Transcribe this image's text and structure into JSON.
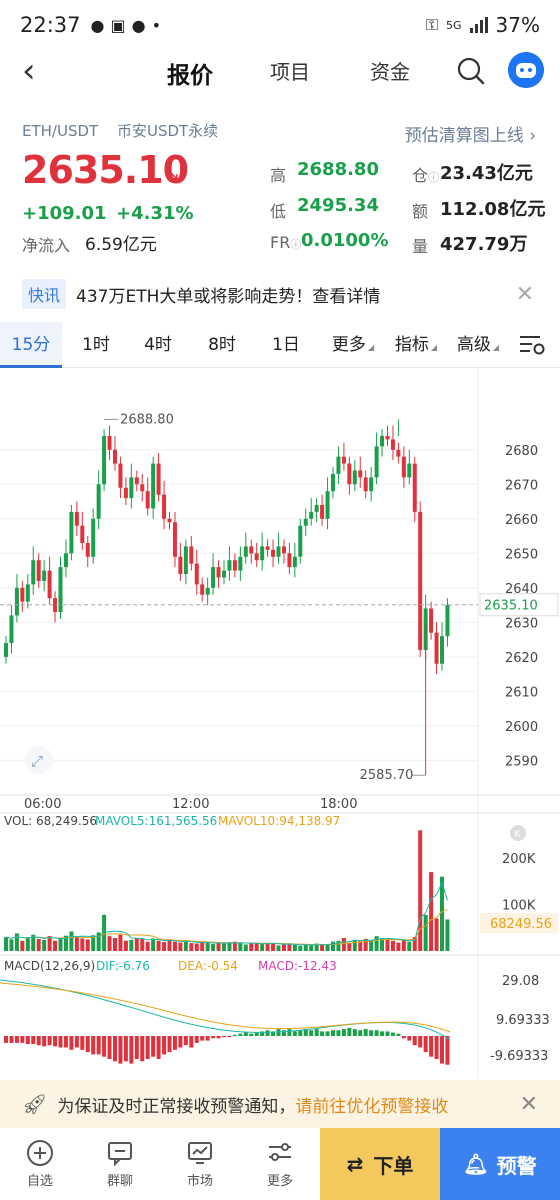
{
  "status_bar": {
    "time": "22:37",
    "battery": "37%",
    "net": "5G"
  },
  "nav": {
    "tabs": [
      "报价",
      "项目",
      "资金"
    ]
  },
  "header": {
    "pair": "ETH/USDT",
    "market": "币安USDT永续",
    "liq_link": "预估清算图上线 ›",
    "price": "2635.10",
    "change_abs": "+109.01",
    "change_pct": "+4.31%",
    "inflow_label": "净流入",
    "inflow_value": "6.59亿元",
    "high_label": "高",
    "high": "2688.80",
    "low_label": "低",
    "low": "2495.34",
    "fr_label": "FR",
    "fr": "0.0100%",
    "oi_label": "仓",
    "oi": "23.43亿元",
    "amount_label": "额",
    "amount": "112.08亿元",
    "volume_label": "量",
    "volume": "427.79万"
  },
  "news": {
    "tag": "快讯",
    "text": "437万ETH大单或将影响走势！查看详情"
  },
  "intervals": [
    "15分",
    "1时",
    "4时",
    "8时",
    "1日",
    "更多",
    "指标",
    "高级"
  ],
  "chart_data": [
    {
      "type": "candlestick",
      "y_ticks": [
        2680,
        2670,
        2660,
        2650,
        2640,
        2630,
        2620,
        2610,
        2600,
        2590
      ],
      "ylim": [
        2582,
        2695
      ],
      "x_ticks": [
        "06:00",
        "12:00",
        "18:00"
      ],
      "high_marker": "2688.80",
      "low_marker": "2585.70",
      "last_price": "2635.10",
      "closes": [
        2624,
        2632,
        2640,
        2636,
        2641,
        2648,
        2642,
        2645,
        2637,
        2633,
        2646,
        2650,
        2662,
        2658,
        2653,
        2649,
        2660,
        2670,
        2684,
        2680,
        2676,
        2669,
        2666,
        2672,
        2670,
        2668,
        2663,
        2676,
        2667,
        2660,
        2659,
        2649,
        2644,
        2652,
        2647,
        2641,
        2638,
        2640,
        2646,
        2643,
        2645,
        2648,
        2645,
        2649,
        2652,
        2650,
        2648,
        2652,
        2651,
        2649,
        2652,
        2650,
        2646,
        2649,
        2658,
        2660,
        2662,
        2664,
        2660,
        2668,
        2673,
        2678,
        2676,
        2670,
        2674,
        2672,
        2668,
        2672,
        2681,
        2684,
        2683,
        2680,
        2678,
        2672,
        2676,
        2662,
        2622,
        2634,
        2627,
        2618,
        2626,
        2635
      ]
    },
    {
      "type": "bar",
      "title": "VOL: 68,249.56",
      "mavol5": "MAVOL5:161,565.56",
      "mavol10": "MAVOL10:94,138.97",
      "y_ticks": [
        "200K",
        "100K"
      ],
      "last": "68249.56",
      "values": [
        30,
        25,
        38,
        22,
        28,
        35,
        26,
        24,
        32,
        22,
        28,
        33,
        42,
        30,
        27,
        25,
        34,
        40,
        78,
        32,
        28,
        35,
        22,
        24,
        28,
        26,
        20,
        27,
        22,
        19,
        24,
        20,
        18,
        22,
        17,
        16,
        20,
        18,
        15,
        17,
        16,
        19,
        20,
        17,
        14,
        16,
        18,
        15,
        17,
        16,
        12,
        14,
        16,
        13,
        11,
        14,
        12,
        16,
        15,
        13,
        20,
        22,
        28,
        18,
        24,
        21,
        26,
        24,
        32,
        28,
        26,
        22,
        18,
        24,
        20,
        30,
        260,
        78,
        170,
        70,
        160,
        68
      ]
    },
    {
      "type": "bar",
      "title": "MACD(12,26,9)",
      "dif": "DIF:-6.76",
      "dea": "DEA:-0.54",
      "macd": "MACD:-12.43",
      "y_ticks": [
        "29.08",
        "9.69333",
        "-9.69333"
      ],
      "values": [
        -3,
        -3,
        -3,
        -3,
        -3.5,
        -3.5,
        -4,
        -4.5,
        -4,
        -4.5,
        -5,
        -5,
        -6,
        -5,
        -6,
        -7,
        -8,
        -8,
        -9,
        -10,
        -11,
        -12,
        -11,
        -12,
        -10,
        -11,
        -10,
        -9,
        -10,
        -8,
        -7,
        -6,
        -5,
        -4,
        -5,
        -3,
        -2,
        -2,
        -1,
        -1,
        -0.5,
        -0.5,
        0.5,
        1,
        1.5,
        1,
        1.5,
        2,
        2.5,
        2,
        3,
        2.5,
        3,
        2,
        2.5,
        3,
        2.5,
        3,
        2,
        2,
        2.5,
        2.5,
        3,
        3.5,
        3,
        2.5,
        3,
        2.5,
        2.5,
        2,
        2,
        1.5,
        1,
        -1,
        -2,
        -4,
        -5,
        -7,
        -9,
        -10,
        -12,
        -12.5
      ]
    }
  ],
  "alert": {
    "text": "为保证及时正常接收预警通知，",
    "link": "请前往优化预警接收"
  },
  "bottom_nav": [
    {
      "label": "自选",
      "icon": "plus-circle-icon"
    },
    {
      "label": "群聊",
      "icon": "chat-icon"
    },
    {
      "label": "市场",
      "icon": "market-chart-icon"
    },
    {
      "label": "更多",
      "icon": "more-sliders-icon"
    }
  ],
  "order_button": "下单",
  "warn_button": "预警",
  "colors": {
    "up": "#1a9f4b",
    "down": "#e0323c",
    "accent": "#3b82f0"
  }
}
